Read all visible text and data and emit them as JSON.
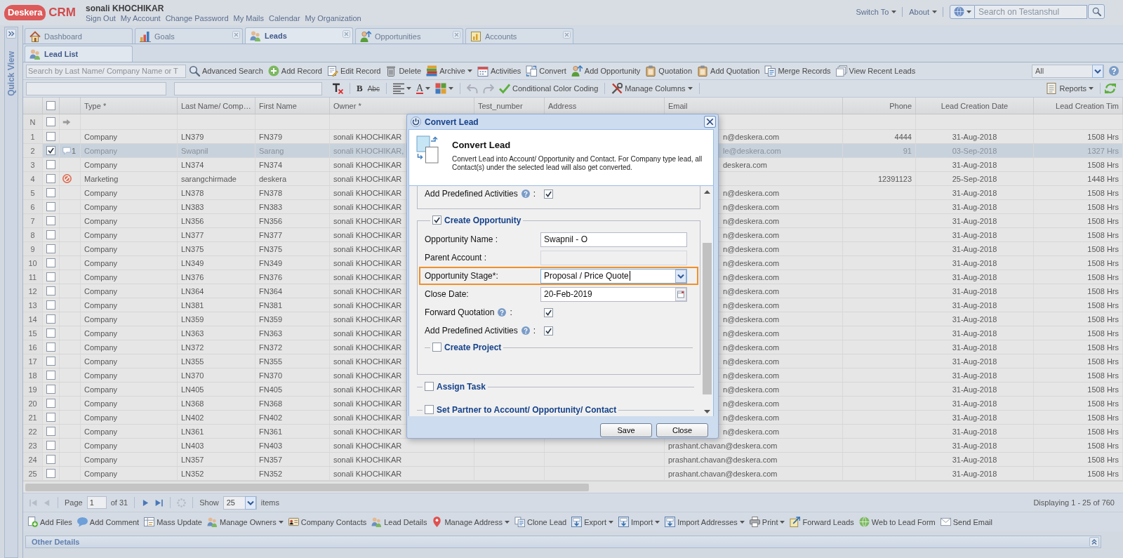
{
  "header": {
    "logo": {
      "brand": "Deskera",
      "product": "CRM"
    },
    "user": "sonali KHOCHIKAR",
    "links": [
      "Sign Out",
      "My Account",
      "Change Password",
      "My Mails",
      "Calendar",
      "My Organization"
    ],
    "menus": [
      {
        "label": "Switch To",
        "dropdown": true
      },
      {
        "label": "About",
        "dropdown": true
      }
    ],
    "search": {
      "placeholder": "Search on Testanshul"
    }
  },
  "quick_view": {
    "title": "Quick View"
  },
  "tabs": [
    {
      "label": "Dashboard",
      "selected": false,
      "closable": false
    },
    {
      "label": "Goals",
      "selected": false,
      "closable": true
    },
    {
      "label": "Leads",
      "selected": true,
      "closable": true
    },
    {
      "label": "Opportunities",
      "selected": false,
      "closable": true
    },
    {
      "label": "Accounts",
      "selected": false,
      "closable": true
    }
  ],
  "subtabs": [
    {
      "label": "Lead List",
      "selected": true
    }
  ],
  "toolbar": {
    "search": {
      "placeholder": "Search by Last Name/ Company Name or T"
    },
    "items": [
      {
        "label": "Advanced Search",
        "dropdown": false
      },
      {
        "label": "Add Record",
        "dropdown": false
      },
      {
        "label": "Edit Record",
        "dropdown": false
      },
      {
        "label": "Delete",
        "dropdown": false
      },
      {
        "label": "Archive",
        "dropdown": true
      },
      {
        "label": "Activities",
        "dropdown": false
      },
      {
        "label": "Convert",
        "dropdown": false
      },
      {
        "label": "Add Opportunity",
        "dropdown": false
      },
      {
        "label": "Quotation",
        "dropdown": false
      },
      {
        "label": "Add Quotation",
        "dropdown": false
      },
      {
        "label": "Merge Records",
        "dropdown": false
      },
      {
        "label": "View Recent Leads",
        "dropdown": false
      }
    ],
    "filter": {
      "value": "All"
    }
  },
  "format_toolbar": {
    "items": [
      {
        "kind": "icon",
        "dropdown": false,
        "disabled": false
      },
      {
        "kind": "separator"
      },
      {
        "kind": "glyph",
        "label": "B",
        "dropdown": false,
        "disabled": false
      },
      {
        "kind": "glyph",
        "label": "Abc",
        "dropdown": false,
        "disabled": false
      },
      {
        "kind": "separator"
      },
      {
        "kind": "icon",
        "dropdown": true,
        "disabled": false
      },
      {
        "kind": "glyph",
        "label": "A",
        "dropdown": true,
        "disabled": false
      },
      {
        "kind": "icon",
        "dropdown": true,
        "disabled": false
      },
      {
        "kind": "separator"
      },
      {
        "kind": "icon",
        "dropdown": false,
        "disabled": true
      },
      {
        "kind": "icon",
        "dropdown": false,
        "disabled": true
      },
      {
        "kind": "button",
        "label": "Conditional Color Coding",
        "dropdown": false,
        "disabled": false
      },
      {
        "kind": "separator"
      },
      {
        "kind": "button",
        "label": "Manage Columns",
        "dropdown": true,
        "disabled": false
      },
      {
        "kind": "separator"
      }
    ],
    "reports": {
      "label": "Reports",
      "dropdown": true
    }
  },
  "grid": {
    "select_all": {
      "checked": false
    },
    "columns": [
      "Type *",
      "Last Name/ Comp…",
      "First Name",
      "Owner *",
      "Test_number",
      "Address",
      "Email",
      "Phone",
      "Lead Creation Date",
      "Lead Creation Tim"
    ],
    "new_row": {
      "label": "N",
      "checked": false
    },
    "rows": [
      {
        "number": "1",
        "checked": false,
        "selected": false,
        "type": "Company",
        "last_name": "LN379",
        "first_name": "FN379",
        "owner": "sonali KHOCHIKAR",
        "email": "n@deskera.com",
        "phone": "4444",
        "created_date": "31-Aug-2018",
        "created_time": "1508 Hrs"
      },
      {
        "number": "2",
        "checked": true,
        "selected": true,
        "indicator": {
          "kind": "comment",
          "count": "1"
        },
        "type": "Company",
        "last_name": "Swapnil",
        "first_name": "Sarang",
        "owner": "sonali KHOCHIKAR,",
        "email": "le@deskera.com",
        "phone": "91",
        "created_date": "03-Sep-2018",
        "created_time": "1327 Hrs"
      },
      {
        "number": "3",
        "checked": false,
        "selected": false,
        "type": "Company",
        "last_name": "LN374",
        "first_name": "FN374",
        "owner": "sonali KHOCHIKAR",
        "email": "deskera.com",
        "created_date": "31-Aug-2018",
        "created_time": "1508 Hrs"
      },
      {
        "number": "4",
        "checked": false,
        "selected": false,
        "indicator": {
          "kind": "blocked"
        },
        "type": "Marketing",
        "last_name": "sarangchirmade",
        "first_name": "deskera",
        "owner": "sonali KHOCHIKAR",
        "phone": "12391123",
        "created_date": "25-Sep-2018",
        "created_time": "1448 Hrs"
      },
      {
        "number": "5",
        "checked": false,
        "selected": false,
        "type": "Company",
        "last_name": "LN378",
        "first_name": "FN378",
        "owner": "sonali KHOCHIKAR",
        "email": "n@deskera.com",
        "created_date": "31-Aug-2018",
        "created_time": "1508 Hrs"
      },
      {
        "number": "6",
        "checked": false,
        "selected": false,
        "type": "Company",
        "last_name": "LN383",
        "first_name": "FN383",
        "owner": "sonali KHOCHIKAR",
        "email": "n@deskera.com",
        "created_date": "31-Aug-2018",
        "created_time": "1508 Hrs"
      },
      {
        "number": "7",
        "checked": false,
        "selected": false,
        "type": "Company",
        "last_name": "LN356",
        "first_name": "FN356",
        "owner": "sonali KHOCHIKAR",
        "email": "n@deskera.com",
        "created_date": "31-Aug-2018",
        "created_time": "1508 Hrs"
      },
      {
        "number": "8",
        "checked": false,
        "selected": false,
        "type": "Company",
        "last_name": "LN377",
        "first_name": "FN377",
        "owner": "sonali KHOCHIKAR",
        "email": "n@deskera.com",
        "created_date": "31-Aug-2018",
        "created_time": "1508 Hrs"
      },
      {
        "number": "9",
        "checked": false,
        "selected": false,
        "type": "Company",
        "last_name": "LN375",
        "first_name": "FN375",
        "owner": "sonali KHOCHIKAR",
        "email": "n@deskera.com",
        "created_date": "31-Aug-2018",
        "created_time": "1508 Hrs"
      },
      {
        "number": "10",
        "checked": false,
        "selected": false,
        "type": "Company",
        "last_name": "LN349",
        "first_name": "FN349",
        "owner": "sonali KHOCHIKAR",
        "email": "n@deskera.com",
        "created_date": "31-Aug-2018",
        "created_time": "1508 Hrs"
      },
      {
        "number": "11",
        "checked": false,
        "selected": false,
        "type": "Company",
        "last_name": "LN376",
        "first_name": "FN376",
        "owner": "sonali KHOCHIKAR",
        "email": "n@deskera.com",
        "created_date": "31-Aug-2018",
        "created_time": "1508 Hrs"
      },
      {
        "number": "12",
        "checked": false,
        "selected": false,
        "type": "Company",
        "last_name": "LN364",
        "first_name": "FN364",
        "owner": "sonali KHOCHIKAR",
        "email": "n@deskera.com",
        "created_date": "31-Aug-2018",
        "created_time": "1508 Hrs"
      },
      {
        "number": "13",
        "checked": false,
        "selected": false,
        "type": "Company",
        "last_name": "LN381",
        "first_name": "FN381",
        "owner": "sonali KHOCHIKAR",
        "email": "n@deskera.com",
        "created_date": "31-Aug-2018",
        "created_time": "1508 Hrs"
      },
      {
        "number": "14",
        "checked": false,
        "selected": false,
        "type": "Company",
        "last_name": "LN359",
        "first_name": "FN359",
        "owner": "sonali KHOCHIKAR",
        "email": "n@deskera.com",
        "created_date": "31-Aug-2018",
        "created_time": "1508 Hrs"
      },
      {
        "number": "15",
        "checked": false,
        "selected": false,
        "type": "Company",
        "last_name": "LN363",
        "first_name": "FN363",
        "owner": "sonali KHOCHIKAR",
        "email": "n@deskera.com",
        "created_date": "31-Aug-2018",
        "created_time": "1508 Hrs"
      },
      {
        "number": "16",
        "checked": false,
        "selected": false,
        "type": "Company",
        "last_name": "LN372",
        "first_name": "FN372",
        "owner": "sonali KHOCHIKAR",
        "email": "n@deskera.com",
        "created_date": "31-Aug-2018",
        "created_time": "1508 Hrs"
      },
      {
        "number": "17",
        "checked": false,
        "selected": false,
        "type": "Company",
        "last_name": "LN355",
        "first_name": "FN355",
        "owner": "sonali KHOCHIKAR",
        "email": "n@deskera.com",
        "created_date": "31-Aug-2018",
        "created_time": "1508 Hrs"
      },
      {
        "number": "18",
        "checked": false,
        "selected": false,
        "type": "Company",
        "last_name": "LN370",
        "first_name": "FN370",
        "owner": "sonali KHOCHIKAR",
        "email": "n@deskera.com",
        "created_date": "31-Aug-2018",
        "created_time": "1508 Hrs"
      },
      {
        "number": "19",
        "checked": false,
        "selected": false,
        "type": "Company",
        "last_name": "LN405",
        "first_name": "FN405",
        "owner": "sonali KHOCHIKAR",
        "email": "n@deskera.com",
        "created_date": "31-Aug-2018",
        "created_time": "1508 Hrs"
      },
      {
        "number": "20",
        "checked": false,
        "selected": false,
        "type": "Company",
        "last_name": "LN368",
        "first_name": "FN368",
        "owner": "sonali KHOCHIKAR",
        "email": "n@deskera.com",
        "created_date": "31-Aug-2018",
        "created_time": "1508 Hrs"
      },
      {
        "number": "21",
        "checked": false,
        "selected": false,
        "type": "Company",
        "last_name": "LN402",
        "first_name": "FN402",
        "owner": "sonali KHOCHIKAR",
        "email": "n@deskera.com",
        "created_date": "31-Aug-2018",
        "created_time": "1508 Hrs"
      },
      {
        "number": "22",
        "checked": false,
        "selected": false,
        "type": "Company",
        "last_name": "LN361",
        "first_name": "FN361",
        "owner": "sonali KHOCHIKAR",
        "email": "n@deskera.com",
        "created_date": "31-Aug-2018",
        "created_time": "1508 Hrs"
      },
      {
        "number": "23",
        "checked": false,
        "selected": false,
        "type": "Company",
        "last_name": "LN403",
        "first_name": "FN403",
        "owner": "sonali KHOCHIKAR",
        "email": "prashant.chavan@deskera.com",
        "created_date": "31-Aug-2018",
        "created_time": "1508 Hrs"
      },
      {
        "number": "24",
        "checked": false,
        "selected": false,
        "type": "Company",
        "last_name": "LN357",
        "first_name": "FN357",
        "owner": "sonali KHOCHIKAR",
        "email": "prashant.chavan@deskera.com",
        "created_date": "31-Aug-2018",
        "created_time": "1508 Hrs"
      },
      {
        "number": "25",
        "checked": false,
        "selected": false,
        "type": "Company",
        "last_name": "LN352",
        "first_name": "FN352",
        "owner": "sonali KHOCHIKAR",
        "email": "prashant.chavan@deskera.com",
        "created_date": "31-Aug-2018",
        "created_time": "1508 Hrs"
      }
    ]
  },
  "pager": {
    "buttons_before": [
      {
        "disabled": true
      },
      {
        "disabled": true
      }
    ],
    "page_label": "Page",
    "page": "1",
    "of": "of 31",
    "buttons_after": [
      {
        "disabled": false
      },
      {
        "disabled": false
      },
      {
        "disabled": true
      }
    ],
    "show_label": "Show",
    "page_size": "25",
    "items_label": "items",
    "summary": "Displaying 1 - 25 of 760"
  },
  "actions": [
    {
      "label": "Add Files",
      "dropdown": false
    },
    {
      "label": "Add Comment",
      "dropdown": false
    },
    {
      "label": "Mass Update",
      "dropdown": false
    },
    {
      "label": "Manage Owners",
      "dropdown": true
    },
    {
      "label": "Company Contacts",
      "dropdown": false
    },
    {
      "label": "Lead Details",
      "dropdown": false
    },
    {
      "label": "Manage Address",
      "dropdown": true
    },
    {
      "label": "Clone Lead",
      "dropdown": false
    },
    {
      "label": "Export",
      "dropdown": true
    },
    {
      "label": "Import",
      "dropdown": true
    },
    {
      "label": "Import Addresses",
      "dropdown": true
    },
    {
      "label": "Print",
      "dropdown": true
    },
    {
      "label": "Forward Leads",
      "dropdown": false
    },
    {
      "label": "Web to Lead Form",
      "dropdown": false
    },
    {
      "label": "Send Email",
      "dropdown": false
    }
  ],
  "other_details": {
    "title": "Other Details"
  },
  "dialog": {
    "title": "Convert Lead",
    "heading": "Convert Lead",
    "description": "Convert Lead into Account/ Opportunity and Contact. For Company type lead, all Contact(s) under the selected lead will also get converted.",
    "sections": [
      {
        "kind": "continued",
        "rows": [
          {
            "kind": "checkbox",
            "label": "Add Predefined Activities",
            "help": true,
            "suffix": ":",
            "checked": true,
            "disabled": false,
            "focused": false,
            "highlighted": false
          }
        ]
      },
      {
        "kind": "group",
        "title": "Create Opportunity",
        "checked": true,
        "rows": [
          {
            "kind": "text",
            "label": "Opportunity Name :",
            "value": "Swapnil - O",
            "help": false,
            "disabled": false,
            "focused": false,
            "highlighted": false
          },
          {
            "kind": "text",
            "label": "Parent Account :",
            "help": false,
            "disabled": true,
            "focused": false,
            "highlighted": false
          },
          {
            "kind": "combo",
            "label": "Opportunity Stage*:",
            "value": "Proposal / Price Quote",
            "help": false,
            "disabled": false,
            "focused": true,
            "highlighted": true
          },
          {
            "kind": "date",
            "label": "Close Date:",
            "value": "20-Feb-2019",
            "help": false,
            "disabled": false,
            "focused": false,
            "highlighted": false
          },
          {
            "kind": "checkbox",
            "label": "Forward Quotation",
            "help": true,
            "suffix": ":",
            "checked": true,
            "disabled": false,
            "focused": false,
            "highlighted": false
          },
          {
            "kind": "checkbox",
            "label": "Add Predefined Activities",
            "help": true,
            "suffix": ":",
            "checked": true,
            "disabled": false,
            "focused": false,
            "highlighted": false
          },
          {
            "kind": "group",
            "title": "Create Project",
            "checked": false
          }
        ]
      },
      {
        "kind": "group",
        "title": "Assign Task",
        "checked": false
      },
      {
        "kind": "group",
        "title": "Set Partner to Account/ Opportunity/ Contact",
        "checked": false
      }
    ],
    "buttons": [
      "Save",
      "Close"
    ]
  }
}
